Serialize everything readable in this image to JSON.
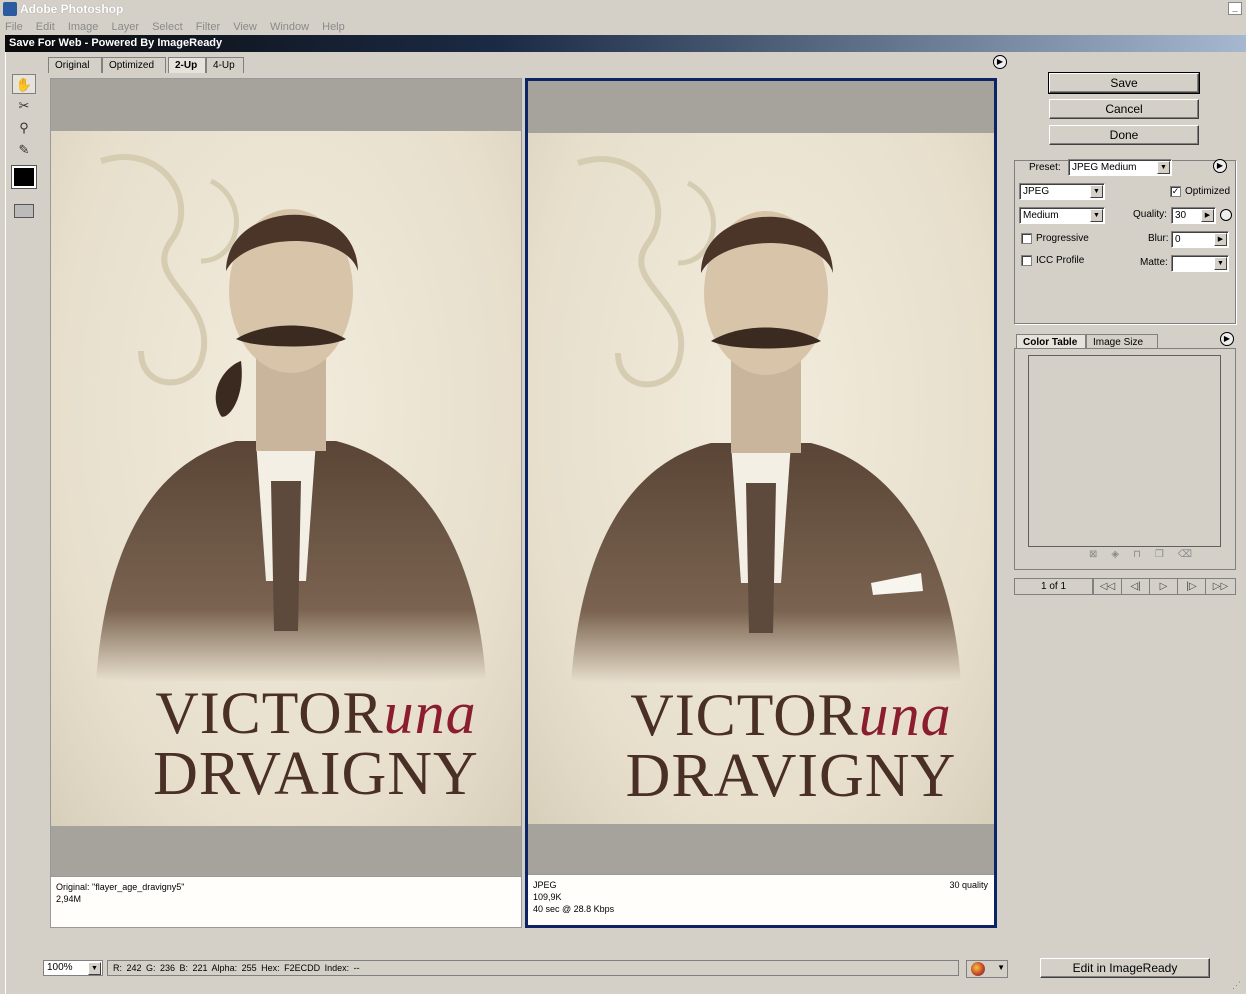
{
  "app": {
    "title": "Adobe Photoshop",
    "minimize": "_"
  },
  "menu": [
    "File",
    "Edit",
    "Image",
    "Layer",
    "Select",
    "Filter",
    "View",
    "Window",
    "Help"
  ],
  "dialog": {
    "title": "Save For Web - Powered By ImageReady"
  },
  "tabs": [
    "Original",
    "Optimized",
    "2-Up",
    "4-Up"
  ],
  "active_tab": "2-Up",
  "tools": [
    "hand-icon",
    "slice-select-icon",
    "zoom-icon",
    "eyedropper-icon"
  ],
  "eyedropper_color": "#000000",
  "panes": {
    "left": {
      "line1": "Original: \"flayer_age_dravigny5\"",
      "line2": "2,94M",
      "line3": "",
      "right": ""
    },
    "right": {
      "line1": "JPEG",
      "line2": "109,9K",
      "line3": "40 sec @ 28.8 Kbps",
      "right": "30 quality"
    }
  },
  "poster": {
    "left": {
      "word1": "VICTOR",
      "word1_red": "una",
      "word2": "DRVAIGNY"
    },
    "right": {
      "word1": "VICTOR",
      "word1_red": "una",
      "word2": "DRAVIGNY"
    }
  },
  "buttons": {
    "save": "Save",
    "cancel": "Cancel",
    "done": "Done",
    "edit_imageready": "Edit in ImageReady"
  },
  "settings": {
    "preset_label": "Preset:",
    "preset_value": "JPEG Medium",
    "format_value": "JPEG",
    "quality_preset_value": "Medium",
    "optimized_label": "Optimized",
    "optimized_checked": true,
    "quality_label": "Quality:",
    "quality_value": "30",
    "progressive_label": "Progressive",
    "blur_label": "Blur:",
    "blur_value": "0",
    "icc_label": "ICC Profile",
    "matte_label": "Matte:"
  },
  "color_table": {
    "tab1": "Color Table",
    "tab2": "Image Size"
  },
  "nav": {
    "count": "1 of 1",
    "first": "◁◁",
    "prev": "◁|",
    "play": "▷",
    "next": "|▷",
    "last": "▷▷"
  },
  "status": {
    "zoom": "100%",
    "text": "R:   242   G:  236   B:   221   Alpha:  255   Hex:   F2ECDD   Index:          --"
  },
  "colors": {
    "accent": "#0a2466",
    "background": "#d4d0c8",
    "poster_text": "#4a2f27",
    "poster_red": "#8b1e2e"
  }
}
